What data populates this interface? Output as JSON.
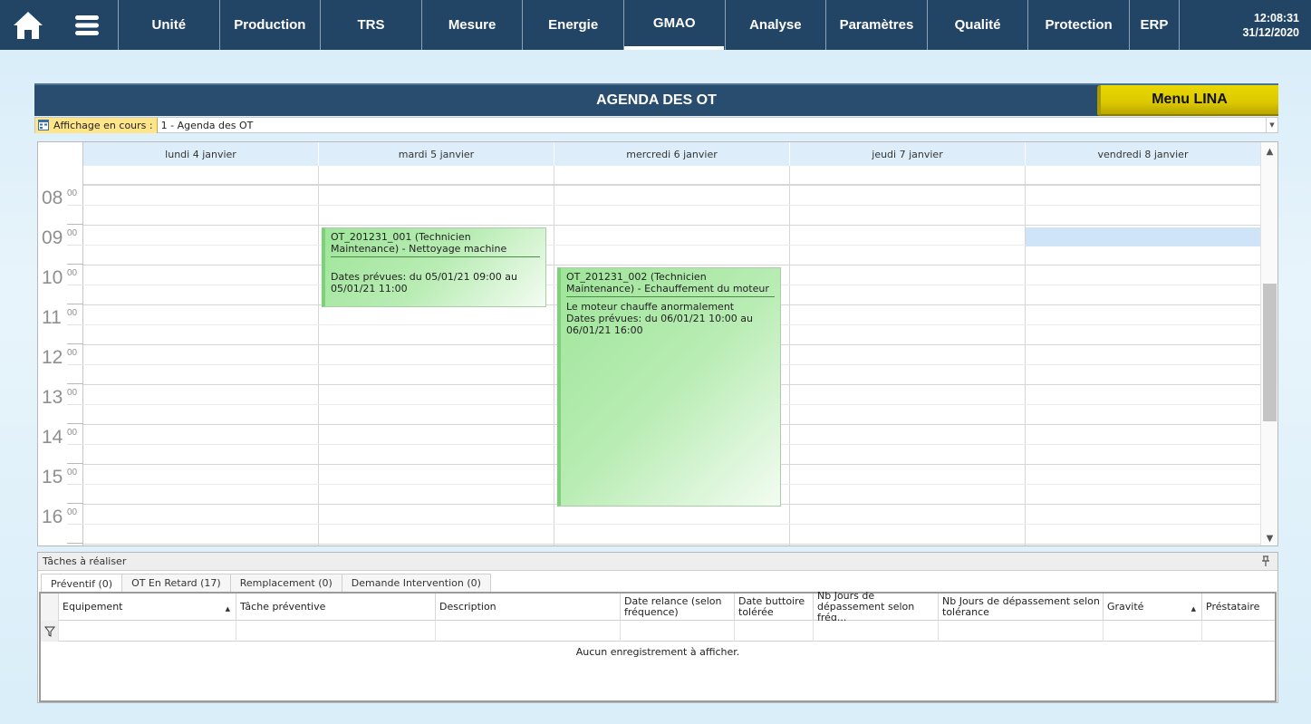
{
  "nav": {
    "home_icon": "home-icon",
    "menu_icon": "hamburger-menu-icon",
    "tabs": [
      {
        "label": "Unité"
      },
      {
        "label": "Production"
      },
      {
        "label": "TRS"
      },
      {
        "label": "Mesure"
      },
      {
        "label": "Energie"
      },
      {
        "label": "GMAO",
        "active": true
      },
      {
        "label": "Analyse"
      },
      {
        "label": "Paramètres"
      },
      {
        "label": "Qualité"
      },
      {
        "label": "Protection"
      },
      {
        "label": "ERP"
      }
    ],
    "time": "12:08:31",
    "date": "31/12/2020"
  },
  "agenda": {
    "title": "AGENDA DES OT",
    "menu_button": "Menu LINA",
    "view_label": "Affichage en cours :",
    "view_value": "1 - Agenda des OT"
  },
  "calendar": {
    "days": [
      "lundi 4 janvier",
      "mardi 5 janvier",
      "mercredi 6 janvier",
      "jeudi 7 janvier",
      "vendredi 8 janvier"
    ],
    "hours": [
      "08",
      "09",
      "10",
      "11",
      "12",
      "13",
      "14",
      "15",
      "16"
    ],
    "minutes": "00",
    "events": [
      {
        "title": "OT_201231_001 (Technicien Maintenance) - Nettoyage machine",
        "description": "",
        "dates": "Dates prévues: du 05/01/21 09:00 au 05/01/21 11:00"
      },
      {
        "title": "OT_201231_002 (Technicien Maintenance) - Echauffement du moteur",
        "description": "Le moteur chauffe anormalement",
        "dates": "Dates prévues: du 06/01/21 10:00 au 06/01/21 16:00"
      }
    ]
  },
  "tasks": {
    "title": "Tâches à réaliser",
    "tabs": [
      "Préventif (0)",
      "OT En Retard (17)",
      "Remplacement (0)",
      "Demande Intervention (0)"
    ],
    "columns": [
      "Equipement",
      "Tâche préventive",
      "Description",
      "Date relance (selon fréquence)",
      "Date buttoire tolérée",
      "Nb Jours de dépassement  selon fréq...",
      "Nb Jours de dépassement selon tolérance",
      "Gravité",
      "Préstataire"
    ],
    "empty_message": "Aucun enregistrement à afficher."
  },
  "colors": {
    "nav_bg": "#234565",
    "header_bg": "#294d6e",
    "menu_lina": "#dcc800",
    "event_green": "#9fe59a",
    "highlight": "#cfe5f7"
  }
}
